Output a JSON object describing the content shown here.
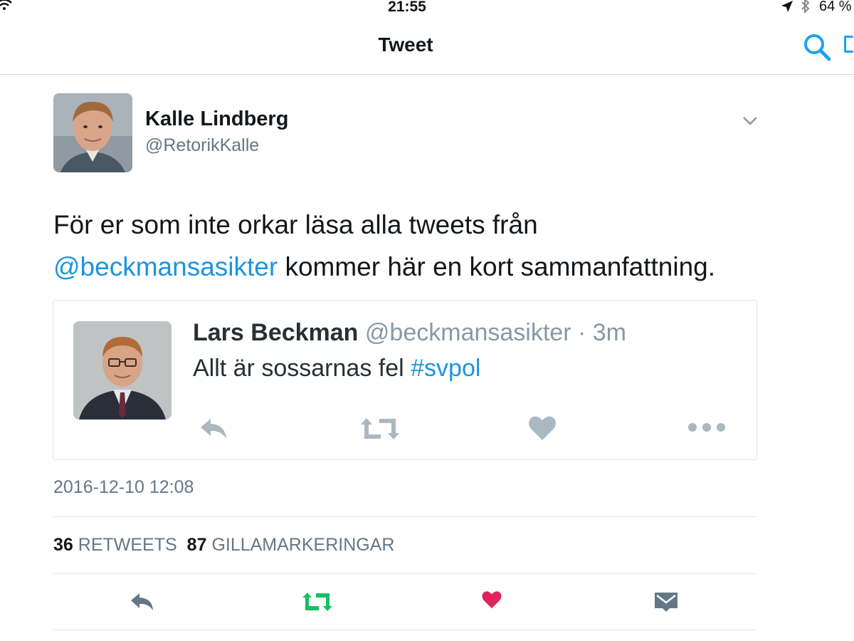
{
  "status_bar": {
    "time": "21:55",
    "battery": "64 %",
    "icons": [
      "wifi-icon",
      "location-arrow-icon",
      "bluetooth-icon"
    ]
  },
  "nav": {
    "title": "Tweet",
    "icons": [
      "search-icon"
    ]
  },
  "tweet": {
    "author_name": "Kalle Lindberg",
    "author_handle": "@RetorikKalle",
    "text_part1": "För er som inte orkar läsa alla tweets från",
    "mention": "@beckmansasikter",
    "text_part2": " kommer här en kort sammanfattning.",
    "timestamp": "2016-12-10 12:08",
    "retweet_count": "36",
    "retweet_label": "RETWEETS",
    "like_count": "87",
    "like_label": "GILLAMARKERINGAR"
  },
  "quoted_tweet": {
    "name": "Lars Beckman",
    "handle_time": " @beckmansasikter · 3m",
    "text": "Allt är sossarnas fel ",
    "hashtag": "#svpol",
    "actions": [
      "reply-icon",
      "retweet-icon",
      "like-icon",
      "more-icon"
    ]
  },
  "actions": [
    "reply-icon",
    "retweet-icon",
    "like-icon",
    "direct-message-icon"
  ],
  "colors": {
    "link": "#1b95e0",
    "search": "#1da1f2",
    "retweet": "#17bf63",
    "like": "#e0245e",
    "icon_gray": "#657786",
    "quote_icon_gray": "#aab8c2",
    "text": "#14171a",
    "secondary": "#657786"
  }
}
